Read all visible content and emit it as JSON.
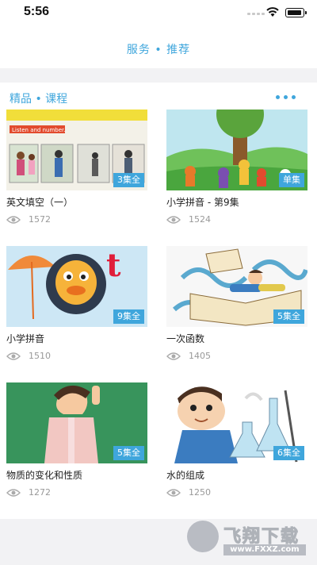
{
  "status_bar": {
    "time": "5:56"
  },
  "header": {
    "title": "服务 • 推荐"
  },
  "section": {
    "title": "精品 • 课程"
  },
  "courses": [
    {
      "title": "英文填空（一）",
      "badge": "3集全",
      "views": "1572"
    },
    {
      "title": "小学拼音 - 第9集",
      "badge": "单集",
      "views": "1524"
    },
    {
      "title": "小学拼音",
      "badge": "9集全",
      "views": "1510"
    },
    {
      "title": "一次函数",
      "badge": "5集全",
      "views": "1405"
    },
    {
      "title": "物质的变化和性质",
      "badge": "5集全",
      "views": "1272"
    },
    {
      "title": "水的组成",
      "badge": "6集全",
      "views": "1250"
    }
  ],
  "thumb_text": {
    "listen": "Listen and number.",
    "letter": "t"
  },
  "watermark": {
    "text": "飞翔下载",
    "url": "www.FXXZ.com"
  },
  "colors": {
    "accent": "#3fa6dc",
    "badge": "#3fa6dc"
  },
  "icons": {
    "views": "eye-icon",
    "more": "more-dots-icon"
  }
}
